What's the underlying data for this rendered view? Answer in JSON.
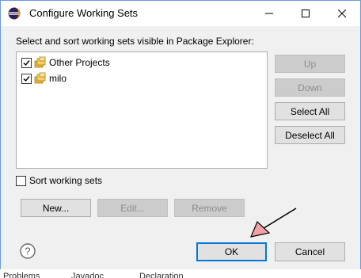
{
  "window": {
    "title": "Configure Working Sets",
    "minimize_icon": "minimize-icon",
    "maximize_icon": "maximize-icon",
    "close_icon": "close-icon"
  },
  "instruction": "Select and sort working sets visible in Package Explorer:",
  "working_sets": [
    {
      "label": "Other Projects",
      "checked": true,
      "icon": "working-set-icon"
    },
    {
      "label": "milo",
      "checked": true,
      "icon": "working-set-icon"
    }
  ],
  "side_buttons": {
    "up": "Up",
    "down": "Down",
    "select_all": "Select All",
    "deselect_all": "Deselect All"
  },
  "sort_option": {
    "label": "Sort working sets",
    "checked": false
  },
  "action_buttons": {
    "new": "New...",
    "edit": "Edit...",
    "remove": "Remove"
  },
  "footer": {
    "ok": "OK",
    "cancel": "Cancel",
    "help_icon": "help-icon"
  },
  "background_tabs": [
    "Problems",
    "Javadoc",
    "Declaration"
  ],
  "colors": {
    "accent": "#0078d7",
    "arrow_fill": "#f4a0a8",
    "folder": "#e8b440"
  }
}
